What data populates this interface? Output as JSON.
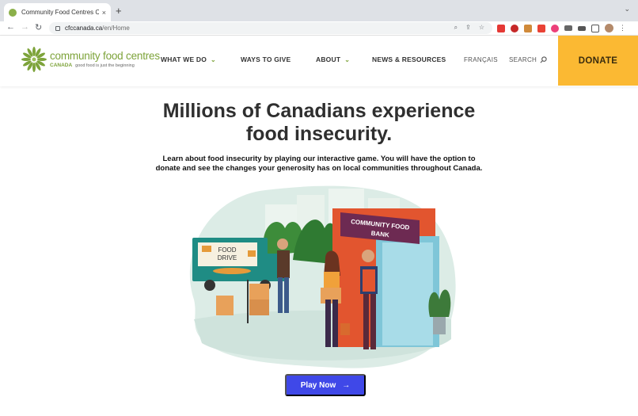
{
  "browser": {
    "tab_title": "Community Food Centres Cana",
    "url_domain": "cfccanada.ca",
    "url_path": "/en/Home",
    "new_tab": "+",
    "close": "×"
  },
  "site": {
    "logo_name": "community food centres",
    "logo_sub": "CANADA",
    "logo_tagline": "good food is just the beginning",
    "nav": [
      {
        "label": "WHAT WE DO",
        "has_dropdown": true
      },
      {
        "label": "WAYS TO GIVE",
        "has_dropdown": false
      },
      {
        "label": "ABOUT",
        "has_dropdown": true
      },
      {
        "label": "NEWS & RESOURCES",
        "has_dropdown": false
      }
    ],
    "language": "FRANÇAIS",
    "search": "SEARCH",
    "donate": "DONATE"
  },
  "hero": {
    "headline_line1": "Millions of Canadians experience",
    "headline_line2": "food insecurity.",
    "intro_line1": "Learn about food insecurity by playing our interactive game. You will have the option to",
    "intro_line2": "donate and see the changes your generosity has on local communities throughout Canada.",
    "truck_sign_line1": "FOOD",
    "truck_sign_line2": "DRIVE",
    "bank_sign_line1": "COMMUNITY FOOD",
    "bank_sign_line2": "BANK",
    "play_button": "Play Now"
  },
  "colors": {
    "donate_bg": "#fbb933",
    "brand_green": "#7da33a",
    "play_bg": "#3f48e8"
  }
}
